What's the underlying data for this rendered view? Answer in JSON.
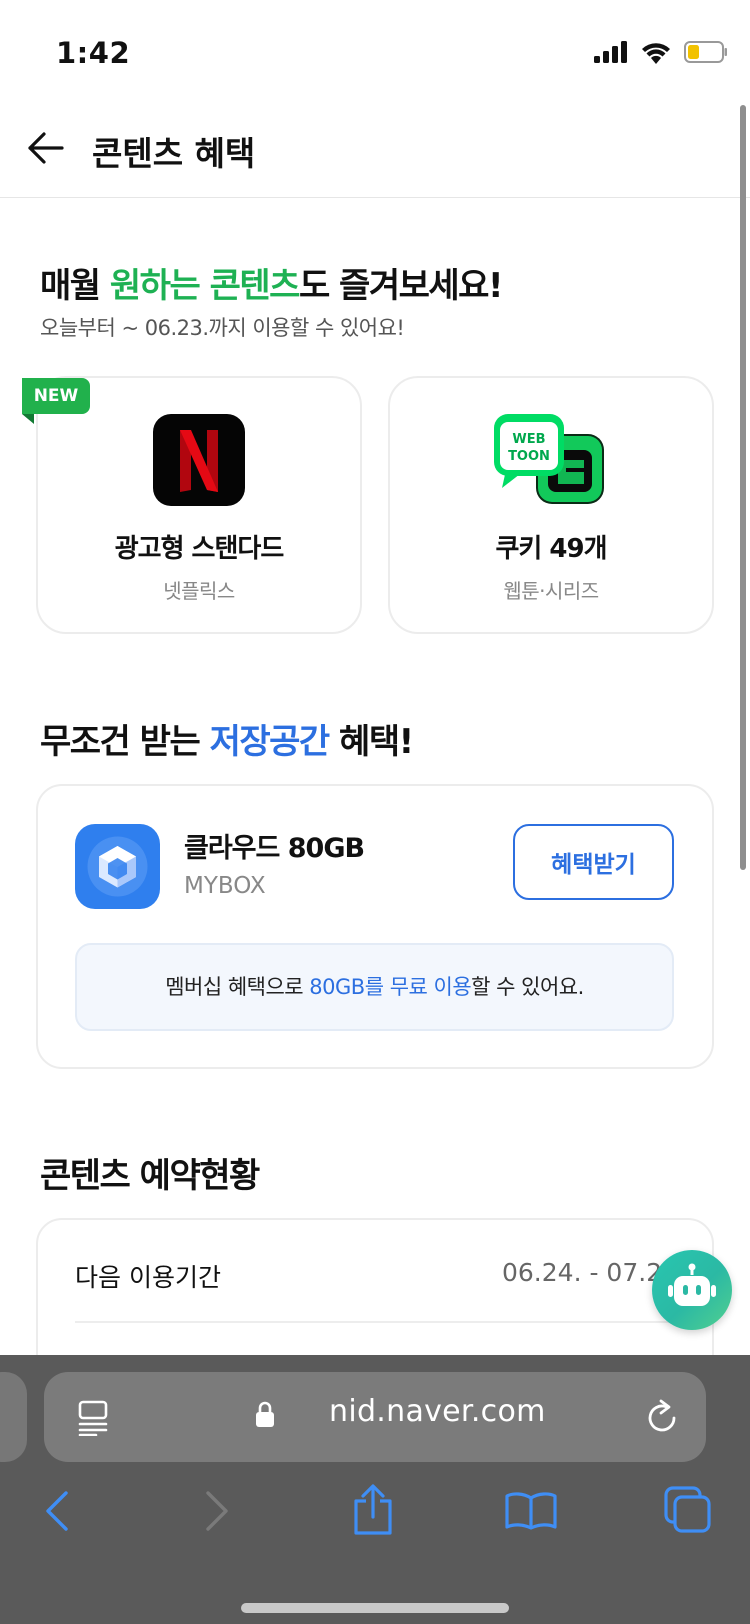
{
  "status_bar": {
    "time": "1:42"
  },
  "header": {
    "title": "콘텐츠 혜택"
  },
  "section_content": {
    "title_part1": "매월 ",
    "title_highlight": "원하는 콘텐츠",
    "title_part2": "도 즐겨보세요!",
    "subtitle": "오늘부터 ~ 06.23.까지 이용할 수 있어요!",
    "cards": [
      {
        "badge": "NEW",
        "title": "광고형 스탠다드",
        "subtitle": "넷플릭스",
        "icon": "netflix-logo"
      },
      {
        "title": "쿠키 49개",
        "subtitle": "웹툰·시리즈",
        "icon": "webtoon-logo",
        "logo_text": "WEB TOON"
      }
    ]
  },
  "section_storage": {
    "title_part1": "무조건 받는 ",
    "title_highlight": "저장공간",
    "title_part2": " 혜택!",
    "item_title": "클라우드 80GB",
    "item_subtitle": "MYBOX",
    "button_label": "혜택받기",
    "notice_part1": "멤버십 혜택으로 ",
    "notice_highlight": "80GB를 무료 이용",
    "notice_part2": "할 수 있어요."
  },
  "section_reservation": {
    "title": "콘텐츠 예약현황",
    "row_label": "다음 이용기간",
    "row_value": "06.24. - 07.2"
  },
  "browser": {
    "url": "nid.naver.com"
  },
  "colors": {
    "green": "#1eb153",
    "blue": "#2c6fe0",
    "badge_green": "#21b14c"
  }
}
